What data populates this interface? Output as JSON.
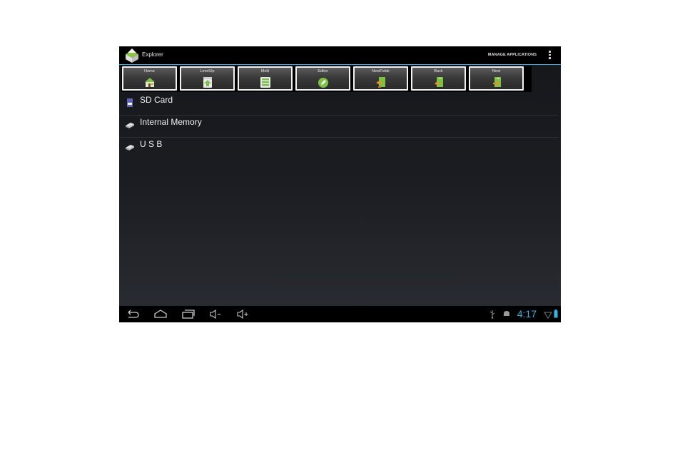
{
  "app": {
    "title": "Explorer",
    "overflow_menu_label": "MANAGE APPLICATIONS"
  },
  "toolbar": {
    "buttons": [
      {
        "label": "Home",
        "icon": "home-icon"
      },
      {
        "label": "LevelUp",
        "icon": "level-up-icon"
      },
      {
        "label": "Multi",
        "icon": "multi-select-icon"
      },
      {
        "label": "Editor",
        "icon": "editor-icon"
      },
      {
        "label": "NewFolde",
        "icon": "new-folder-icon"
      },
      {
        "label": "Back",
        "icon": "back-icon"
      },
      {
        "label": "Next",
        "icon": "next-icon"
      }
    ]
  },
  "storage": {
    "items": [
      {
        "name": "SD Card",
        "icon": "sd-card-icon"
      },
      {
        "name": "Internal Memory",
        "icon": "drive-icon"
      },
      {
        "name": "U S B",
        "icon": "drive-icon"
      }
    ]
  },
  "system_bar": {
    "nav": [
      "back-icon",
      "home-icon",
      "recent-apps-icon",
      "volume-down-icon",
      "volume-up-icon"
    ],
    "clock": "4:17",
    "status_icons": [
      "usb-icon",
      "android-debug-icon",
      "wifi-icon",
      "battery-icon"
    ]
  },
  "colors": {
    "accent": "#33b5e5",
    "icon_green": "#7cc242"
  }
}
